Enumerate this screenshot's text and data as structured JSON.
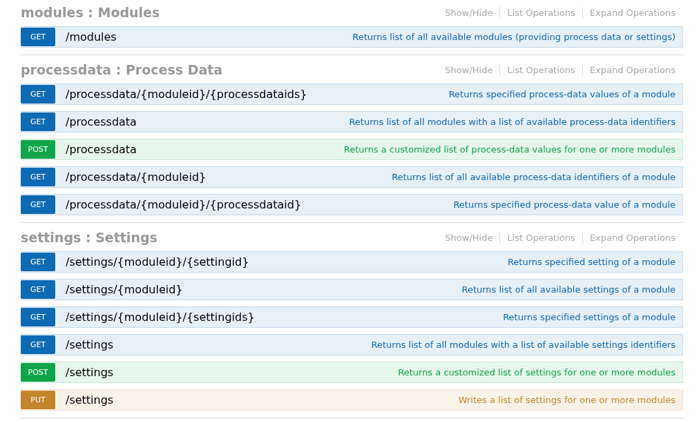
{
  "sections": [
    {
      "title": "modules : Modules",
      "links": [
        "Show/Hide",
        "List Operations",
        "Expand Operations"
      ],
      "operations": [
        {
          "kind": "get",
          "method": "GET",
          "path": "/modules",
          "summary": "Returns list of all available modules (providing process data or settings)"
        }
      ]
    },
    {
      "title": "processdata : Process Data",
      "links": [
        "Show/Hide",
        "List Operations",
        "Expand Operations"
      ],
      "operations": [
        {
          "kind": "get",
          "method": "GET",
          "path": "/processdata/{moduleid}/{processdataids}",
          "summary": "Returns specified process-data values of a module"
        },
        {
          "kind": "get",
          "method": "GET",
          "path": "/processdata",
          "summary": "Returns list of all modules with a list of available process-data identifiers"
        },
        {
          "kind": "post",
          "method": "POST",
          "path": "/processdata",
          "summary": "Returns a customized list of process-data values for one or more modules"
        },
        {
          "kind": "get",
          "method": "GET",
          "path": "/processdata/{moduleid}",
          "summary": "Returns list of all available process-data identifiers of a module"
        },
        {
          "kind": "get",
          "method": "GET",
          "path": "/processdata/{moduleid}/{processdataid}",
          "summary": "Returns specified process-data value of a module"
        }
      ]
    },
    {
      "title": "settings : Settings",
      "links": [
        "Show/Hide",
        "List Operations",
        "Expand Operations"
      ],
      "operations": [
        {
          "kind": "get",
          "method": "GET",
          "path": "/settings/{moduleid}/{settingid}",
          "summary": "Returns specified setting of a module"
        },
        {
          "kind": "get",
          "method": "GET",
          "path": "/settings/{moduleid}",
          "summary": "Returns list of all available settings of a module"
        },
        {
          "kind": "get",
          "method": "GET",
          "path": "/settings/{moduleid}/{settingids}",
          "summary": "Returns specified settings of a module"
        },
        {
          "kind": "get",
          "method": "GET",
          "path": "/settings",
          "summary": "Returns list of all modules with a list of available settings identifiers"
        },
        {
          "kind": "post",
          "method": "POST",
          "path": "/settings",
          "summary": "Returns a customized list of settings for one or more modules"
        },
        {
          "kind": "put",
          "method": "PUT",
          "path": "/settings",
          "summary": "Writes a list of settings for one or more modules"
        }
      ]
    }
  ]
}
